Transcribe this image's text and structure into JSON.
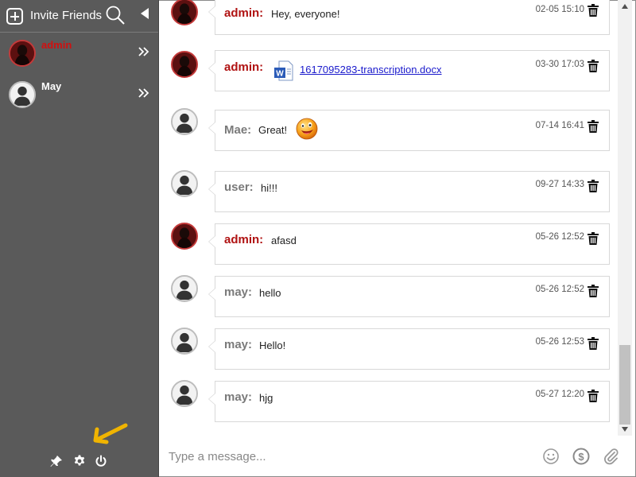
{
  "sidebar": {
    "invite_label": "Invite Friends",
    "contacts": [
      {
        "name": "admin",
        "name_color": "#d01010",
        "avatar": "photo"
      },
      {
        "name": "May",
        "name_color": "#ffffff",
        "avatar": "default"
      }
    ],
    "bottom_icons": [
      "pin-icon",
      "gear-icon",
      "power-icon"
    ]
  },
  "messages": [
    {
      "sender": "admin:",
      "type": "admin",
      "text": "Hey, everyone!",
      "time": "02-05 15:10"
    },
    {
      "sender": "admin:",
      "type": "admin",
      "file": "1617095283-transcription.docx",
      "time": "03-30 17:03"
    },
    {
      "sender": "Mae:",
      "type": "user",
      "text": "Great!",
      "emoji": "grinning-face",
      "time": "07-14 16:41"
    },
    {
      "sender": "user:",
      "type": "user",
      "text": "hi!!!",
      "time": "09-27 14:33"
    },
    {
      "sender": "admin:",
      "type": "admin",
      "text": "afasd",
      "time": "05-26 12:52"
    },
    {
      "sender": "may:",
      "type": "user",
      "text": "hello",
      "time": "05-26 12:52"
    },
    {
      "sender": "may:",
      "type": "user",
      "text": "Hello!",
      "time": "05-26 12:53"
    },
    {
      "sender": "may:",
      "type": "user",
      "text": "hjg",
      "time": "05-27 12:20"
    }
  ],
  "input": {
    "placeholder": "Type a message...",
    "value": ""
  },
  "colors": {
    "sidebar_bg": "#5a5a5a",
    "admin_color": "#b01212",
    "user_color": "#7a7a7a",
    "arrow_color": "#f0b400"
  }
}
